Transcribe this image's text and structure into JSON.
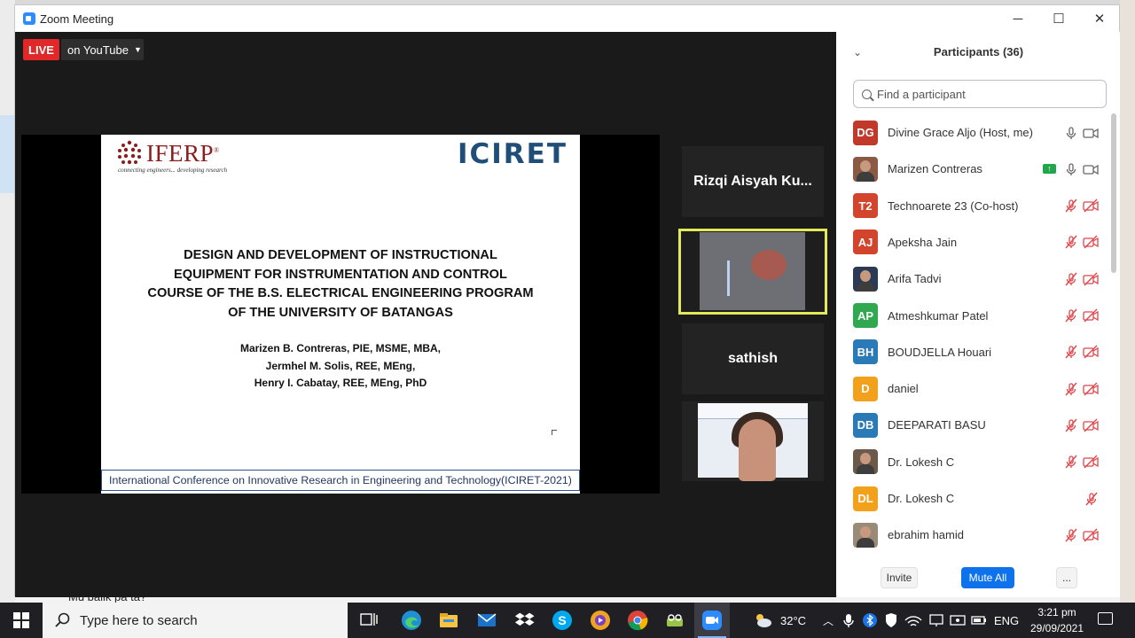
{
  "window": {
    "title": "Zoom Meeting",
    "minimize": "─",
    "maximize": "☐",
    "close": "✕"
  },
  "stream": {
    "live_label": "LIVE",
    "platform_label": "on YouTube"
  },
  "slide": {
    "logo_left": "IFERP",
    "logo_left_registered": "®",
    "logo_left_tagline": "connecting engineers... developing research",
    "logo_right": "ICIRET",
    "title_lines": [
      "DESIGN AND DEVELOPMENT OF INSTRUCTIONAL",
      "EQUIPMENT FOR INSTRUMENTATION AND CONTROL",
      "COURSE OF THE B.S. ELECTRICAL ENGINEERING PROGRAM",
      "OF THE UNIVERSITY OF BATANGAS"
    ],
    "authors": [
      "Marizen B. Contreras, PIE, MSME, MBA,",
      "Jermhel M. Solis, REE, MEng,",
      "Henry I. Cabatay, REE, MEng, PhD"
    ],
    "footer": "International Conference on Innovative Research in Engineering and Technology(ICIRET-2021)"
  },
  "gallery": [
    {
      "name": "Rizqi  Aisyah Ku..."
    },
    {
      "name": ""
    },
    {
      "name": "sathish"
    },
    {
      "name": ""
    }
  ],
  "panel": {
    "title": "Participants (36)",
    "search_placeholder": "Find a participant",
    "participants": [
      {
        "initials": "DG",
        "name": "Divine Grace Aljo (Host, me)",
        "color": "#c0392b",
        "photo": false,
        "mic": "on",
        "video": "on",
        "sharing": false
      },
      {
        "initials": "",
        "name": "Marizen Contreras",
        "color": "#8a5a44",
        "photo": true,
        "mic": "on",
        "video": "on",
        "sharing": true
      },
      {
        "initials": "T2",
        "name": "Technoarete 23 (Co-host)",
        "color": "#d2452c",
        "photo": false,
        "mic": "muted",
        "video": "off",
        "sharing": false
      },
      {
        "initials": "AJ",
        "name": "Apeksha Jain",
        "color": "#d2452c",
        "photo": false,
        "mic": "muted",
        "video": "off",
        "sharing": false
      },
      {
        "initials": "",
        "name": "Arifa Tadvi",
        "color": "#2b3a55",
        "photo": true,
        "mic": "muted",
        "video": "off",
        "sharing": false
      },
      {
        "initials": "AP",
        "name": "Atmeshkumar Patel",
        "color": "#2fa84f",
        "photo": false,
        "mic": "muted",
        "video": "off",
        "sharing": false
      },
      {
        "initials": "BH",
        "name": "BOUDJELLA Houari",
        "color": "#2a7ab8",
        "photo": false,
        "mic": "muted",
        "video": "off",
        "sharing": false
      },
      {
        "initials": "D",
        "name": "daniel",
        "color": "#f2a11c",
        "photo": false,
        "mic": "muted",
        "video": "off",
        "sharing": false
      },
      {
        "initials": "DB",
        "name": "DEEPARATI BASU",
        "color": "#2a7ab8",
        "photo": false,
        "mic": "muted",
        "video": "off",
        "sharing": false
      },
      {
        "initials": "",
        "name": "Dr. Lokesh C",
        "color": "#6b5a4a",
        "photo": true,
        "mic": "muted",
        "video": "off",
        "sharing": false
      },
      {
        "initials": "DL",
        "name": "Dr. Lokesh C",
        "color": "#f2a11c",
        "photo": false,
        "mic": "muted",
        "video": "none",
        "sharing": false
      },
      {
        "initials": "",
        "name": "ebrahim hamid",
        "color": "#9a8a78",
        "photo": true,
        "mic": "muted",
        "video": "off",
        "sharing": false
      }
    ],
    "invite_label": "Invite",
    "mute_all_label": "Mute All",
    "more_label": "..."
  },
  "background": {
    "chat_snippet": "Mu balik pa ta?"
  },
  "taskbar": {
    "search_placeholder": "Type here to search",
    "weather": "32°C",
    "language": "ENG",
    "time": "3:21 pm",
    "date": "29/09/2021"
  }
}
